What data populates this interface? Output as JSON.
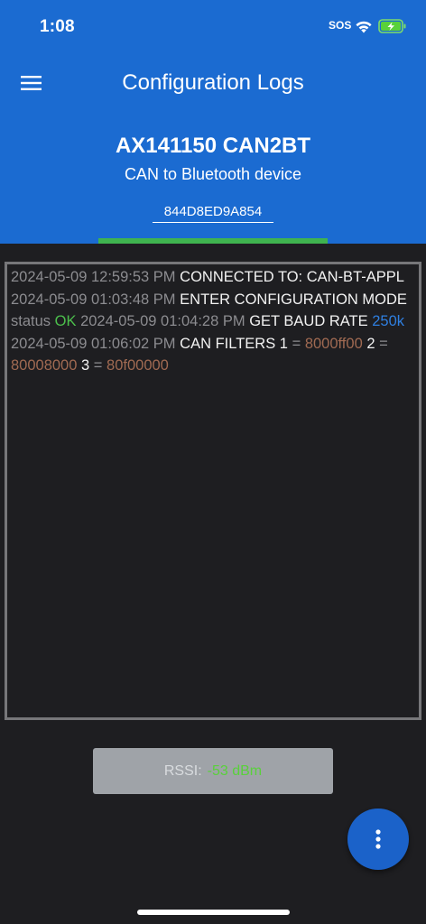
{
  "status_bar": {
    "time": "1:08",
    "sos": "SOS",
    "wifi_icon": "wifi-icon",
    "battery_icon": "battery-charging-icon"
  },
  "appbar": {
    "menu_icon": "hamburger-menu-icon",
    "title": "Configuration Logs"
  },
  "device": {
    "name": "AX141150 CAN2BT",
    "description": "CAN to Bluetooth device",
    "id": "844D8ED9A854"
  },
  "logs": [
    {
      "timestamp": "2024-05-09 12:59:53 PM",
      "command": "CONNECTED TO: CAN-BT-APPL"
    },
    {
      "timestamp": "2024-05-09 01:03:48 PM",
      "command": "ENTER CONFIGURATION MODE",
      "label": "status",
      "value": "OK"
    },
    {
      "timestamp": "2024-05-09 01:04:28 PM",
      "command": "GET BAUD RATE",
      "value": "250k"
    },
    {
      "timestamp": "2024-05-09 01:06:02 PM",
      "command": "CAN FILTERS",
      "filters": [
        {
          "index": "1",
          "eq": "=",
          "value": "8000ff00"
        },
        {
          "index": "2",
          "eq": "=",
          "value": "80008000"
        },
        {
          "index": "3",
          "eq": "=",
          "value": "80f00000"
        }
      ]
    }
  ],
  "rssi": {
    "label": "RSSI:",
    "value": "-53 dBm"
  },
  "fab": {
    "icon": "more-vertical-icon"
  },
  "colors": {
    "header": "#1b6bd1",
    "indicator": "#3fb34f",
    "ok": "#4cbf4c",
    "baud": "#2f7fe0",
    "hex": "#a06a52",
    "rssi_value": "#59d13b"
  }
}
